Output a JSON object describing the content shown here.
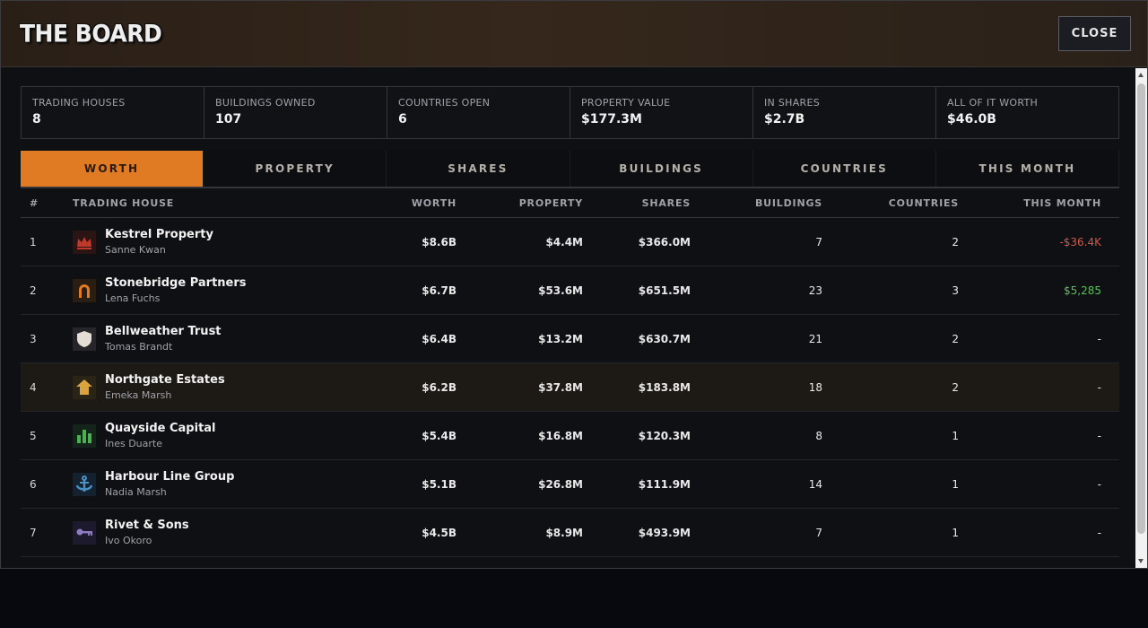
{
  "header": {
    "title": "THE BOARD",
    "close_label": "CLOSE"
  },
  "stats": [
    {
      "label": "TRADING HOUSES",
      "value": "8"
    },
    {
      "label": "BUILDINGS OWNED",
      "value": "107"
    },
    {
      "label": "COUNTRIES OPEN",
      "value": "6"
    },
    {
      "label": "PROPERTY VALUE",
      "value": "$177.3M"
    },
    {
      "label": "IN SHARES",
      "value": "$2.7B"
    },
    {
      "label": "ALL OF IT WORTH",
      "value": "$46.0B"
    }
  ],
  "tabs": [
    "WORTH",
    "PROPERTY",
    "SHARES",
    "BUILDINGS",
    "COUNTRIES",
    "THIS MONTH"
  ],
  "active_tab": "WORTH",
  "table": {
    "columns": [
      "#",
      "TRADING HOUSE",
      "WORTH",
      "PROPERTY",
      "SHARES",
      "BUILDINGS",
      "COUNTRIES",
      "THIS MONTH"
    ],
    "rows": [
      {
        "rank": "1",
        "name": "Kestrel Property",
        "owner": "Sanne Kwan",
        "worth": "$8.6B",
        "property": "$4.4M",
        "shares": "$366.0M",
        "buildings": "7",
        "countries": "2",
        "month": "-$36.4K",
        "trend": "neg",
        "icon": "crown-icon",
        "icon_bg": "#2a1414",
        "icon_color": "#c0392b"
      },
      {
        "rank": "2",
        "name": "Stonebridge Partners",
        "owner": "Lena Fuchs",
        "worth": "$6.7B",
        "property": "$53.6M",
        "shares": "$651.5M",
        "buildings": "23",
        "countries": "3",
        "month": "$5,285",
        "trend": "pos",
        "icon": "horseshoe-icon",
        "icon_bg": "#2a1e12",
        "icon_color": "#e07b24"
      },
      {
        "rank": "3",
        "name": "Bellweather Trust",
        "owner": "Tomas Brandt",
        "worth": "$6.4B",
        "property": "$13.2M",
        "shares": "$630.7M",
        "buildings": "21",
        "countries": "2",
        "month": "-",
        "trend": "none",
        "icon": "shield-icon",
        "icon_bg": "#26262a",
        "icon_color": "#e4ded6"
      },
      {
        "rank": "4",
        "name": "Northgate Estates",
        "owner": "Emeka Marsh",
        "worth": "$6.2B",
        "property": "$37.8M",
        "shares": "$183.8M",
        "buildings": "18",
        "countries": "2",
        "month": "-",
        "trend": "none",
        "icon": "house-icon",
        "icon_bg": "#2a2416",
        "icon_color": "#d9a440"
      },
      {
        "rank": "5",
        "name": "Quayside Capital",
        "owner": "Ines Duarte",
        "worth": "$5.4B",
        "property": "$16.8M",
        "shares": "$120.3M",
        "buildings": "8",
        "countries": "1",
        "month": "-",
        "trend": "none",
        "icon": "bar-chart-icon",
        "icon_bg": "#15241a",
        "icon_color": "#4caf50"
      },
      {
        "rank": "6",
        "name": "Harbour Line Group",
        "owner": "Nadia Marsh",
        "worth": "$5.1B",
        "property": "$26.8M",
        "shares": "$111.9M",
        "buildings": "14",
        "countries": "1",
        "month": "-",
        "trend": "none",
        "icon": "anchor-icon",
        "icon_bg": "#142230",
        "icon_color": "#4a90c2"
      },
      {
        "rank": "7",
        "name": "Rivet & Sons",
        "owner": "Ivo Okoro",
        "worth": "$4.5B",
        "property": "$8.9M",
        "shares": "$493.9M",
        "buildings": "7",
        "countries": "1",
        "month": "-",
        "trend": "none",
        "icon": "key-icon",
        "icon_bg": "#1e1a2e",
        "icon_color": "#8e7cc3"
      }
    ]
  },
  "colors": {
    "accent": "#e07b24",
    "negative": "#d0584a",
    "positive": "#5cbf5c"
  }
}
